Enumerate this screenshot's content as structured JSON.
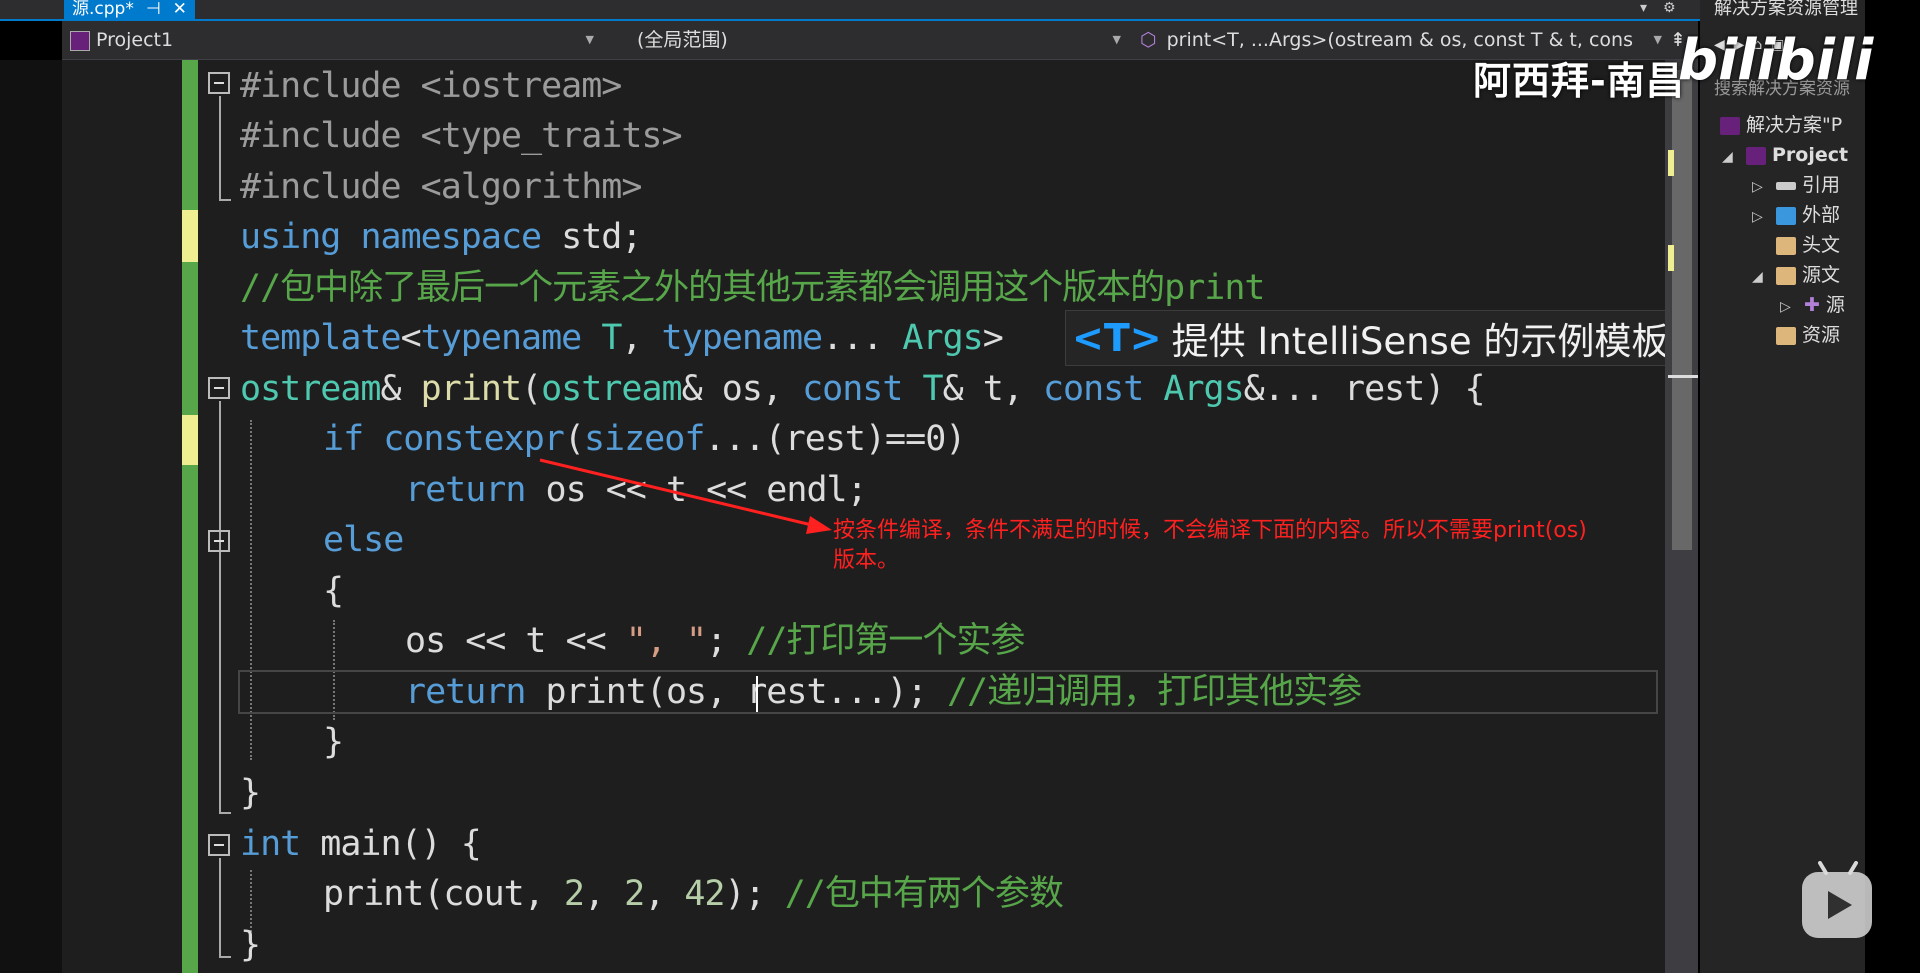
{
  "tab": {
    "label": "源.cpp*",
    "pin": "⊣",
    "close": "✕"
  },
  "navbar": {
    "project": "Project1",
    "scope": "(全局范围)",
    "member": "print<T, ...Args>(ostream & os, const T & t, cons"
  },
  "code": {
    "l1": "#include <iostream>",
    "l2": "#include <type_traits>",
    "l3": "#include <algorithm>",
    "l4": {
      "kw1": "using",
      "kw2": "namespace",
      "rest": " std;"
    },
    "l5": "//包中除了最后一个元素之外的其他元素都会调用这个版本的print",
    "l6": {
      "kw": "template",
      "p1": "<",
      "tn1": "typename",
      "t": "T",
      "p2": ", ",
      "tn2": "typename",
      "p3": "... ",
      "args": "Args",
      "p4": ">"
    },
    "l7": {
      "ty1": "ostream",
      "p1": "& ",
      "fn": "print",
      "p2": "(",
      "ty2": "ostream",
      "p3": "& os, ",
      "c1": "const",
      "sp": " ",
      "t": "T",
      "p4": "& t, ",
      "c2": "const",
      "sp2": " ",
      "args": "Args",
      "p5": "&... rest) {"
    },
    "l8": {
      "kw": "if",
      "kw2": "constexpr",
      "p1": "(",
      "kw3": "sizeof",
      "p2": "...(rest)==0)"
    },
    "l9": {
      "kw": "return",
      "rest": " os << t << endl;"
    },
    "l10": "else",
    "l11": "{",
    "l12": {
      "code": "os << t << ",
      "str": "\", \"",
      "semi": "; ",
      "cm": "//打印第一个实参"
    },
    "l13": {
      "kw": "return",
      "rest": " print(os, rest...); ",
      "cm": "//递归调用，打印其他实参"
    },
    "l14": "}",
    "l15": "}",
    "l16": {
      "kw": "int",
      "rest": " main() {"
    },
    "l17": {
      "code": "print(cout, ",
      "n1": "2",
      "p1": ", ",
      "n2": "2",
      "p2": ", ",
      "n3": "42",
      "p3": "); ",
      "cm": "//包中有两个参数"
    },
    "l18": "}"
  },
  "intellisense": {
    "tag": "<T>",
    "text": "提供 IntelliSense 的示例模板参"
  },
  "annotation": {
    "line1": "按条件编译，条件不满足的时候，不会编译下面的内容。所以不需要print(os)",
    "line2": "版本。"
  },
  "solution_explorer": {
    "title": "解决方案资源管理",
    "search": "搜索解决方案资源",
    "items": [
      {
        "label": "解决方案\"P"
      },
      {
        "label": "Project"
      },
      {
        "label": "引用"
      },
      {
        "label": "外部"
      },
      {
        "label": "头文"
      },
      {
        "label": "源文"
      },
      {
        "label": "源"
      },
      {
        "label": "资源"
      }
    ]
  },
  "watermark": {
    "author": "阿西拜-南昌",
    "logo": "bilibili"
  },
  "colors": {
    "accent": "#007acc",
    "changebar": "#57a64a",
    "annotation": "#ff2020",
    "keyword": "#569cd6",
    "type": "#4ec9b0",
    "comment": "#57a64a"
  }
}
